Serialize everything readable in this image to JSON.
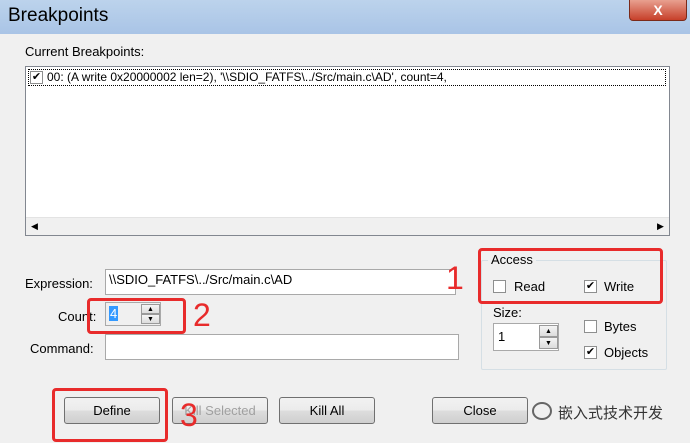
{
  "window": {
    "title": "Breakpoints",
    "close_glyph": "X"
  },
  "current_breakpoints": {
    "label": "Current Breakpoints:",
    "items": [
      {
        "checked": true,
        "text": "00: (A write 0x20000002 len=2),  '\\\\SDIO_FATFS\\../Src/main.c\\AD',  count=4,"
      }
    ]
  },
  "expression": {
    "label": "Expression:",
    "value": "\\\\SDIO_FATFS\\../Src/main.c\\AD"
  },
  "count": {
    "label": "Count:",
    "value": "4"
  },
  "command": {
    "label": "Command:",
    "value": ""
  },
  "access": {
    "title": "Access",
    "read": {
      "label": "Read",
      "checked": false
    },
    "write": {
      "label": "Write",
      "checked": true
    }
  },
  "size": {
    "label": "Size:",
    "value": "1"
  },
  "bytes": {
    "label": "Bytes",
    "checked": false
  },
  "objects": {
    "label": "Objects",
    "checked": true
  },
  "buttons": {
    "define": "Define",
    "kill_selected": "Kill Selected",
    "kill_all": "Kill All",
    "close": "Close"
  },
  "annotations": {
    "n1": "1",
    "n2": "2",
    "n3": "3"
  },
  "watermark": "嵌入式技术开发",
  "colors": {
    "highlight_red": "#e82b2b",
    "titlebar": "#bcd3ec"
  }
}
